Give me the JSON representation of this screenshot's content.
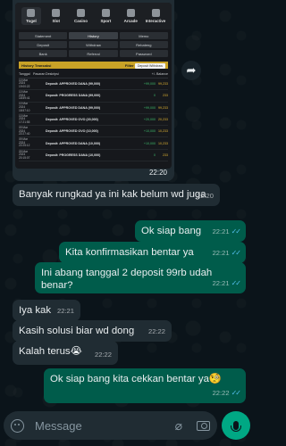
{
  "image_message": {
    "time": "22:20",
    "screenshot": {
      "nav": [
        {
          "label": "Togel",
          "active": true
        },
        {
          "label": "Slot",
          "active": false
        },
        {
          "label": "Casino",
          "active": false
        },
        {
          "label": "Sport",
          "active": false
        },
        {
          "label": "Arcade",
          "active": false
        },
        {
          "label": "Interactive",
          "active": false
        }
      ],
      "tabs": [
        "Statement",
        "History",
        "Memo",
        "Deposit",
        "Withdraw",
        "Rebateng",
        "Bank",
        "Referral",
        "Password"
      ],
      "section_title": "History Transaksi",
      "filter_label": "Filter",
      "filter_value": "Deposit Withdraw",
      "columns": [
        "Tanggal",
        "Pasaran",
        "Deskripsi",
        "+/-",
        "Balance"
      ],
      "rows": [
        {
          "date": "10 Mar 2024 19:00:22",
          "desc": "Deposit: APPROVED DANA (99,000)",
          "amount": "+99,000",
          "balance": "99,233"
        },
        {
          "date": "10 Mar 2024 18:59:41",
          "desc": "Deposit: PROGRESS DANA (99,000)",
          "amount": "0",
          "balance": "233"
        },
        {
          "date": "10 Mar 2024 18:57:10",
          "desc": "Deposit: APPROVED DANA (99,000)",
          "amount": "+99,000",
          "balance": "99,233"
        },
        {
          "date": "10 Mar 2024 17:21:55",
          "desc": "Deposit: APPROVED OVO (20,000)",
          "amount": "+20,000",
          "balance": "20,233"
        },
        {
          "date": "09 Mar 2024 22:27:40",
          "desc": "Deposit: APPROVED OVO (10,000)",
          "amount": "+10,000",
          "balance": "10,233"
        },
        {
          "date": "09 Mar 2024 22:25:12",
          "desc": "Deposit: APPROVED DANA (10,000)",
          "amount": "+10,000",
          "balance": "10,233"
        },
        {
          "date": "09 Mar 2024 20:15:07",
          "desc": "Deposit: PROGRESS DANA (10,000)",
          "amount": "0",
          "balance": "233"
        }
      ]
    }
  },
  "messages": [
    {
      "dir": "in",
      "text": "Banyak rungkad ya ini kak belum wd juga",
      "time": "22:20"
    },
    {
      "dir": "out",
      "text": "Ok siap bang",
      "time": "22:21"
    },
    {
      "dir": "out",
      "text": "Kita konfirmasikan bentar ya",
      "time": "22:21"
    },
    {
      "dir": "out",
      "text": "Ini abang tanggal 2 deposit 99rb udah benar?",
      "time": "22:21"
    },
    {
      "dir": "in",
      "text": "Iya kak",
      "time": "22:21"
    },
    {
      "dir": "in",
      "text": "Kasih solusi biar wd dong",
      "time": "22:22"
    },
    {
      "dir": "in",
      "text": "Kalah terus😭",
      "time": "22:22"
    },
    {
      "dir": "out",
      "text": "Ok siap bang kita cekkan bentar ya🧐",
      "time": "22:22"
    }
  ],
  "composer": {
    "placeholder": "Message"
  }
}
